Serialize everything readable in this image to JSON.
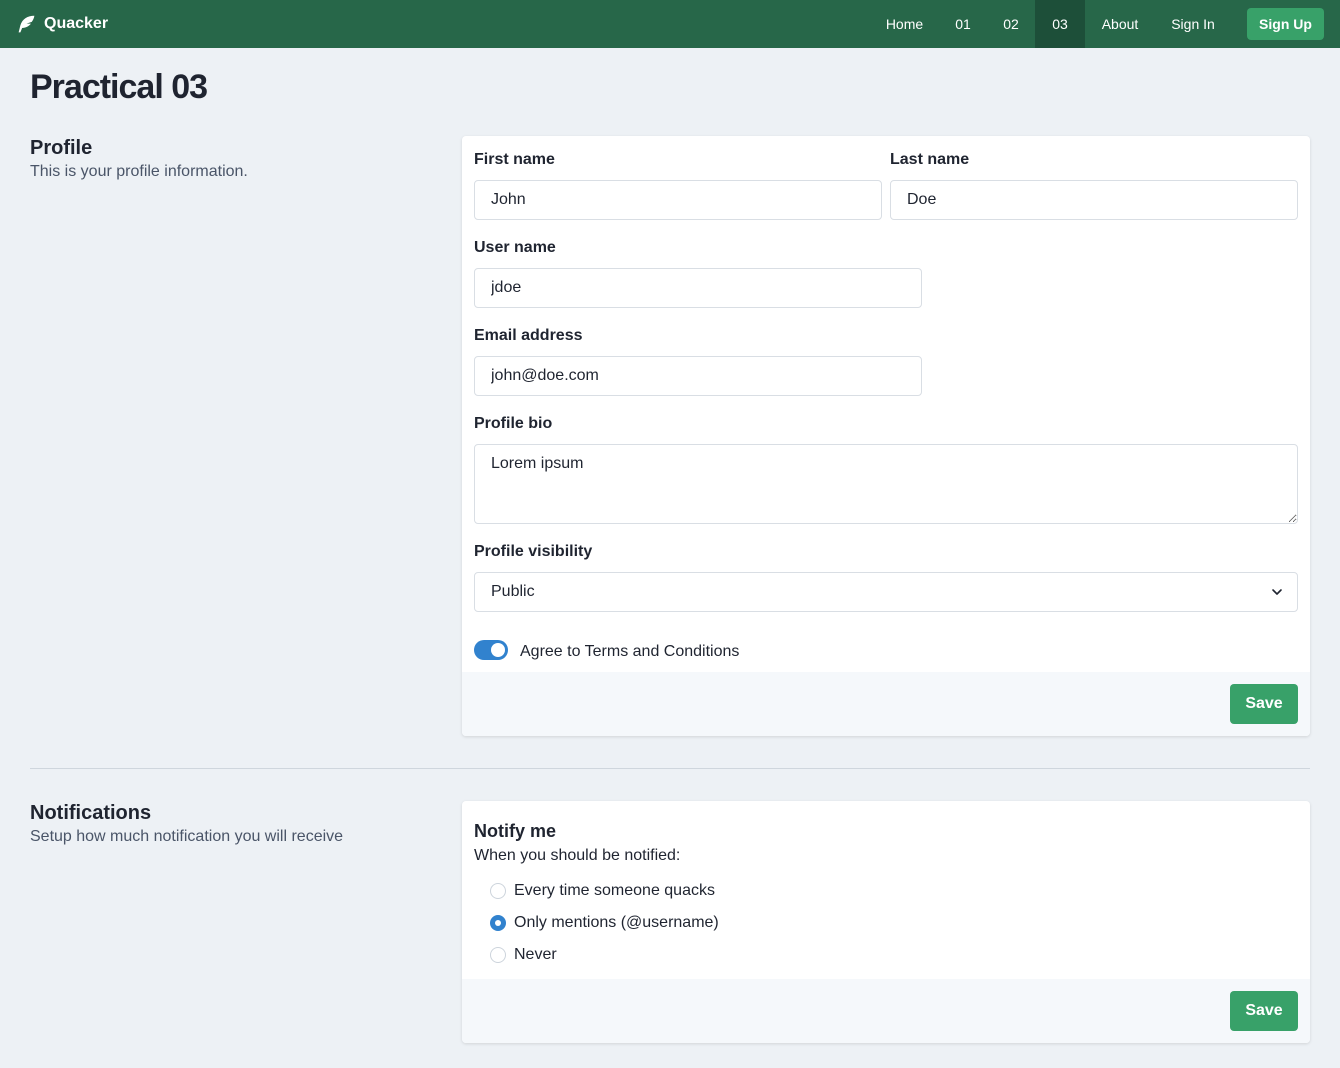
{
  "nav": {
    "brand": "Quacker",
    "items": [
      {
        "label": "Home"
      },
      {
        "label": "01"
      },
      {
        "label": "02"
      },
      {
        "label": "03",
        "active": true
      },
      {
        "label": "About"
      },
      {
        "label": "Sign In"
      }
    ],
    "signup_label": "Sign Up"
  },
  "page": {
    "title": "Practical 03"
  },
  "profile": {
    "title": "Profile",
    "description": "This is your profile information.",
    "first_name_label": "First name",
    "first_name_value": "John",
    "last_name_label": "Last name",
    "last_name_value": "Doe",
    "username_label": "User name",
    "username_value": "jdoe",
    "email_label": "Email address",
    "email_value": "john@doe.com",
    "bio_label": "Profile bio",
    "bio_value": "Lorem ipsum",
    "visibility_label": "Profile visibility",
    "visibility_value": "Public",
    "terms_label": "Agree to Terms and Conditions",
    "terms_checked": true,
    "save_label": "Save"
  },
  "notifications": {
    "title": "Notifications",
    "description": "Setup how much notification you will receive",
    "notify_title": "Notify me",
    "notify_subtitle": "When you should be notified:",
    "options": [
      {
        "label": "Every time someone quacks",
        "checked": false
      },
      {
        "label": "Only mentions (@username)",
        "checked": true
      },
      {
        "label": "Never",
        "checked": false
      }
    ],
    "save_label": "Save"
  },
  "colors": {
    "navbar": "#276749",
    "accent": "#38a169",
    "toggle": "#3182ce"
  },
  "icons": {
    "brand": "feather-icon",
    "select": "chevron-down-icon"
  }
}
